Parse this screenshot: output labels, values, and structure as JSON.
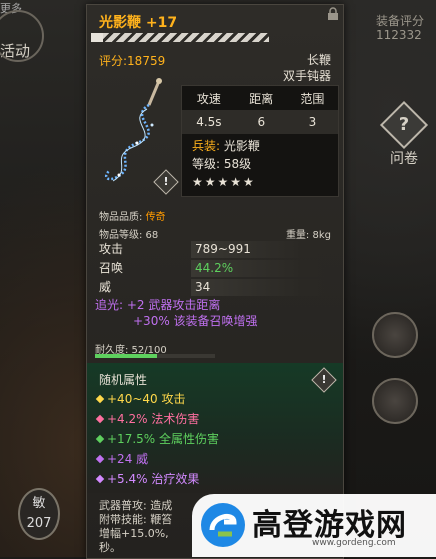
{
  "background": {
    "top_text": "更多",
    "activity_label": "活动",
    "score_label": "装备评分",
    "score_value": "112332",
    "question_label": "问卷",
    "stat_label": "敏",
    "stat_value": "207"
  },
  "item": {
    "title": "光影鞭 +17",
    "score": "评分:18759",
    "weapon_type": "长鞭",
    "weapon_sub": "双手钝器",
    "stats_headers": [
      "攻速",
      "距离",
      "范围"
    ],
    "stats_values": [
      "4.5s",
      "6",
      "3"
    ],
    "equip_key": "兵装:",
    "equip_name": "光影鞭",
    "level_text": "等级: 58级",
    "stars": "★★★★★",
    "star_count": 5,
    "quality_label": "物品品质:",
    "quality_value": "传奇",
    "item_level": "物品等级: 68",
    "weight": "重量: 8kg",
    "attributes": [
      {
        "label": "攻击",
        "value": "789~991",
        "color": "#e8e2d6"
      },
      {
        "label": "召唤",
        "value": "44.2%",
        "color": "#5ed05e"
      },
      {
        "label": "威",
        "value": "34",
        "color": "#e8e2d6"
      }
    ],
    "bonus_line_1": "追光: +2 武器攻击距离",
    "bonus_line_2": "+30% 该装备召唤增强",
    "durability_text": "耐久度: 52/100",
    "durability_fraction": 0.52,
    "random_title": "随机属性",
    "random_attrs": [
      {
        "text": "+40~40 攻击",
        "color": "#ffd84a"
      },
      {
        "text": "+4.2% 法术伤害",
        "color": "#ff6fa0"
      },
      {
        "text": "+17.5% 全属性伤害",
        "color": "#5ed05e"
      },
      {
        "text": "+24 威",
        "color": "#c070f0"
      },
      {
        "text": "+5.4% 治疗效果",
        "color": "#d28aff"
      }
    ],
    "skill_line_1": "武器普攻: 造成",
    "skill_line_2": "附带技能: 鞭笞",
    "skill_line_3": "增幅+15.0%,",
    "skill_line_4": "秒。"
  },
  "watermark": {
    "brand": "高登游戏网",
    "url": "www.gordeng.com"
  },
  "colors": {
    "title_gold": "#ffb21c",
    "legendary_orange": "#ff9a00",
    "bonus_purple": "#c070f0",
    "positive_green": "#5ed05e"
  }
}
